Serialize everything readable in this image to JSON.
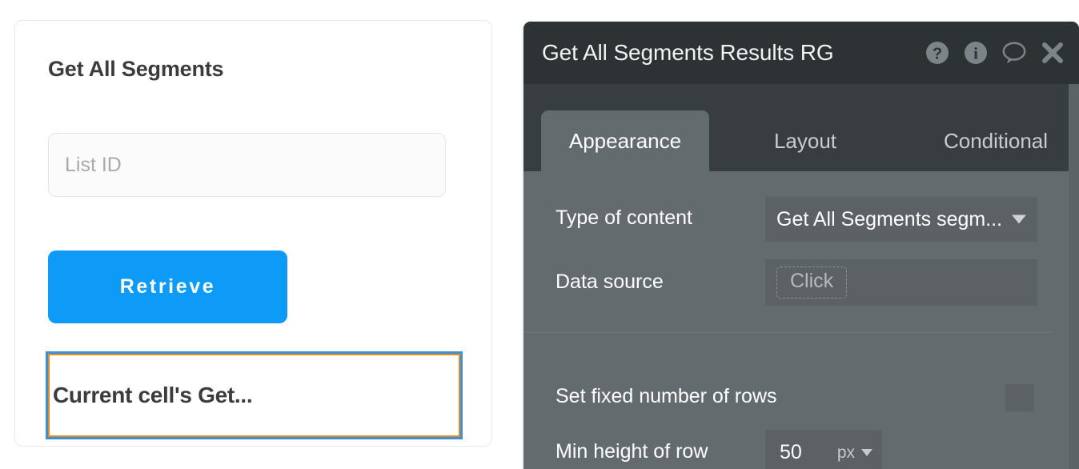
{
  "preview": {
    "title": "Get All Segments",
    "list_id_placeholder": "List ID",
    "retrieve_label": "Retrieve",
    "selected_element_text": "Current cell's Get...",
    "accent_button_color": "#0d9bf7",
    "selection_outer_color": "#3d8fd6",
    "selection_inner_color": "#e88a1c"
  },
  "panel": {
    "title": "Get All Segments Results RG",
    "header_icons": [
      {
        "name": "help-icon",
        "glyph": "?"
      },
      {
        "name": "info-icon",
        "glyph": "i"
      },
      {
        "name": "comment-icon",
        "glyph": "speech-bubble"
      },
      {
        "name": "close-icon",
        "glyph": "x"
      }
    ],
    "tabs": [
      {
        "label": "Appearance",
        "active": true
      },
      {
        "label": "Layout",
        "active": false
      },
      {
        "label": "Conditional",
        "active": false
      }
    ],
    "properties": {
      "type_of_content": {
        "label": "Type of content",
        "value": "Get All Segments segm...",
        "control": "dropdown"
      },
      "data_source": {
        "label": "Data source",
        "value": "Click",
        "control": "click-chip"
      },
      "set_fixed_number_of_rows": {
        "label": "Set fixed number of rows",
        "checked": false,
        "control": "checkbox"
      },
      "min_height_of_row": {
        "label": "Min height of row",
        "value": "50",
        "unit": "px",
        "control": "number-with-unit"
      }
    }
  }
}
